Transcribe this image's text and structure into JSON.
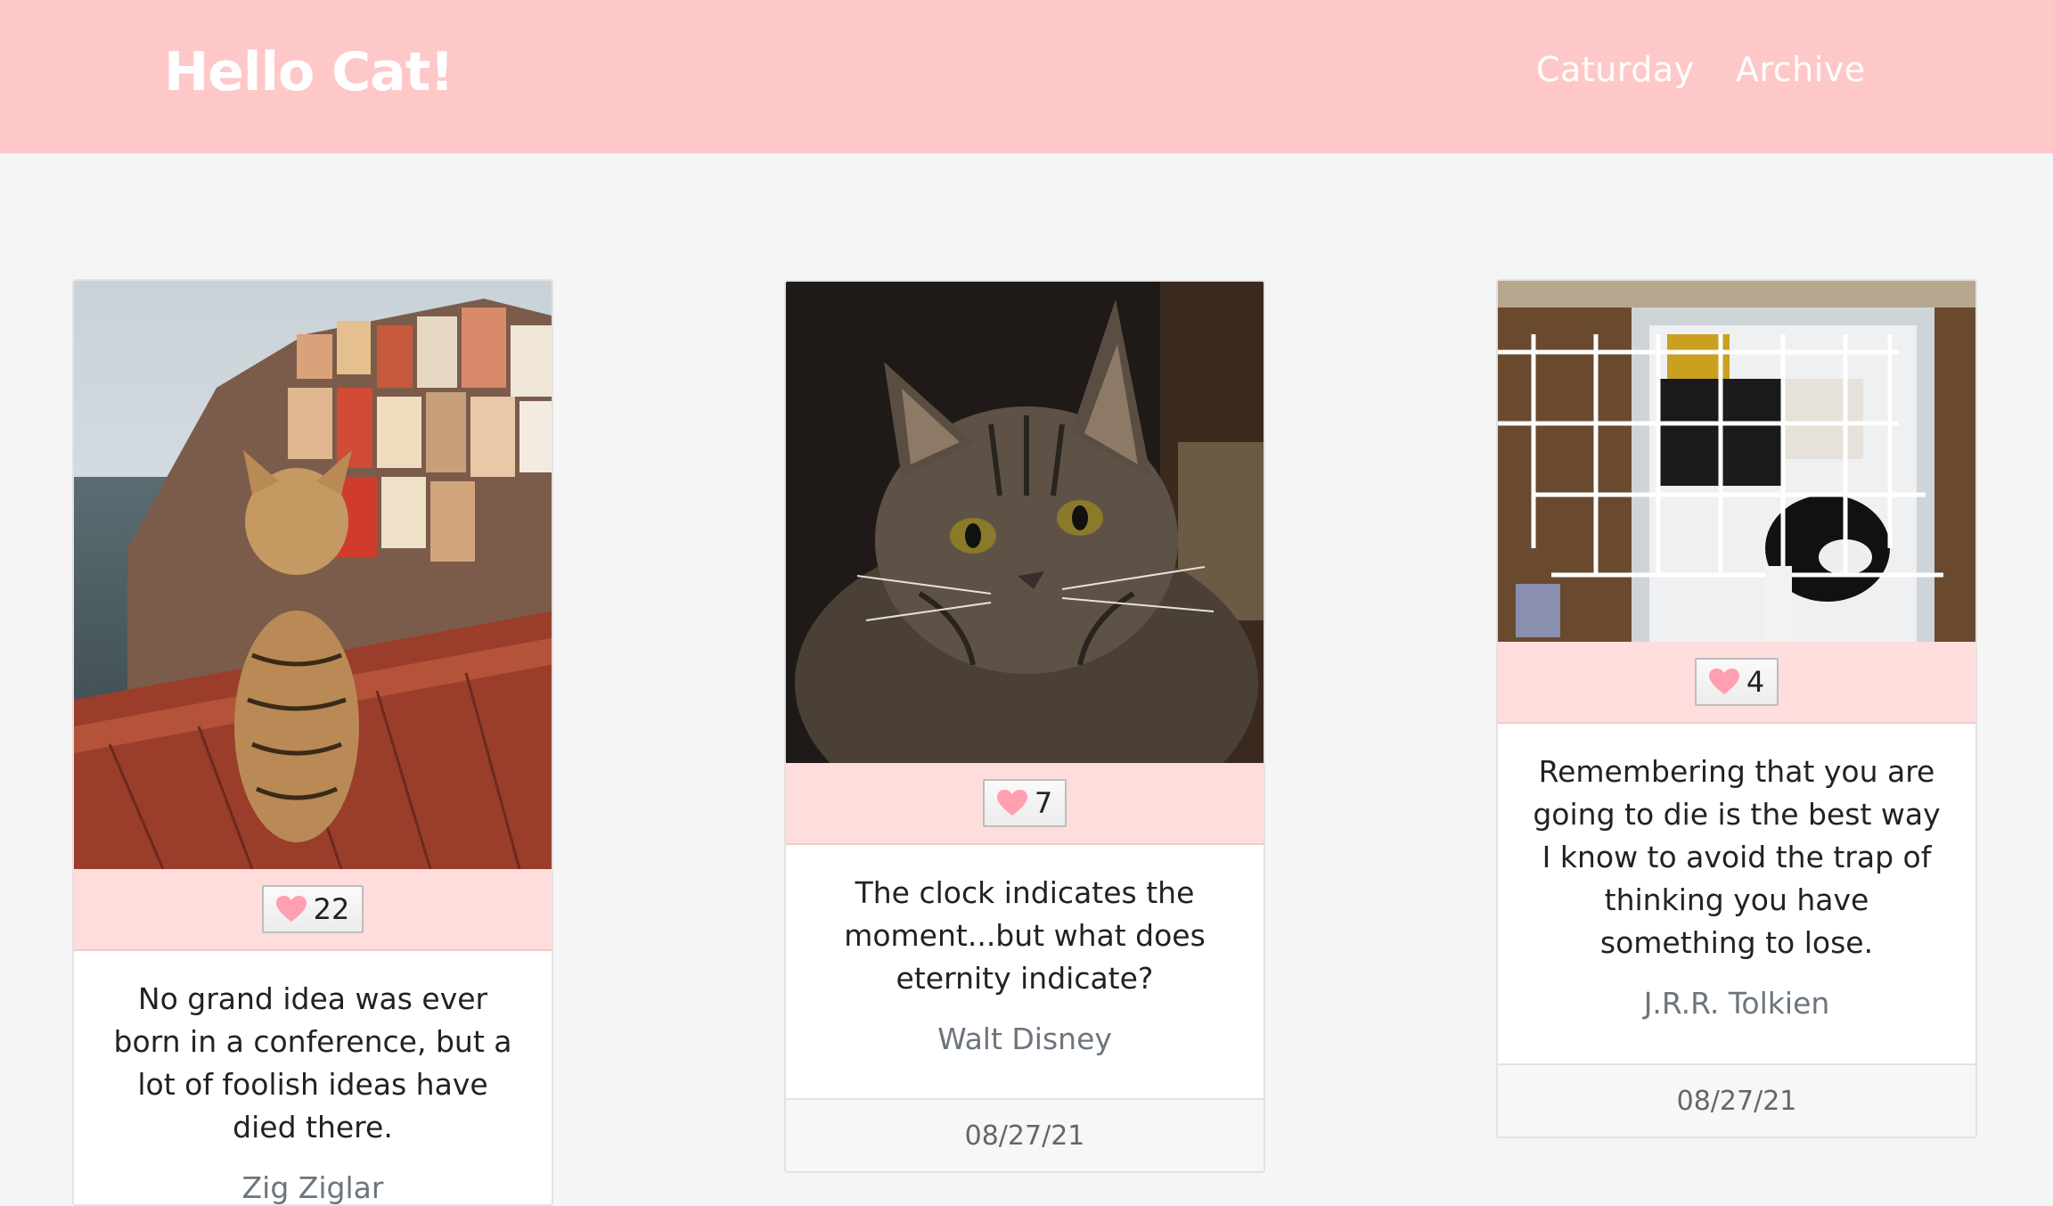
{
  "header": {
    "brand": "Hello Cat!",
    "nav": [
      "Caturday",
      "Archive"
    ]
  },
  "colors": {
    "navbar": "#ffc8c8",
    "like_bar": "#ffdddd",
    "heart": "#ff9fb0",
    "background": "#f5f5f5"
  },
  "cards": [
    {
      "likes": "22",
      "quote": "No grand idea was ever born in a conference, but a lot of foolish ideas have died there.",
      "author": "Zig Ziglar",
      "date": ""
    },
    {
      "likes": "7",
      "quote": "The clock indicates the moment...but what does eternity indicate?",
      "author": "Walt Disney",
      "date": "08/27/21"
    },
    {
      "likes": "4",
      "quote": "Remembering that you are going to die is the best way I know to avoid the trap of thinking you have something to lose.",
      "author": "J.R.R. Tolkien",
      "date": "08/27/21"
    }
  ],
  "icons": {
    "like": "heart-icon"
  }
}
